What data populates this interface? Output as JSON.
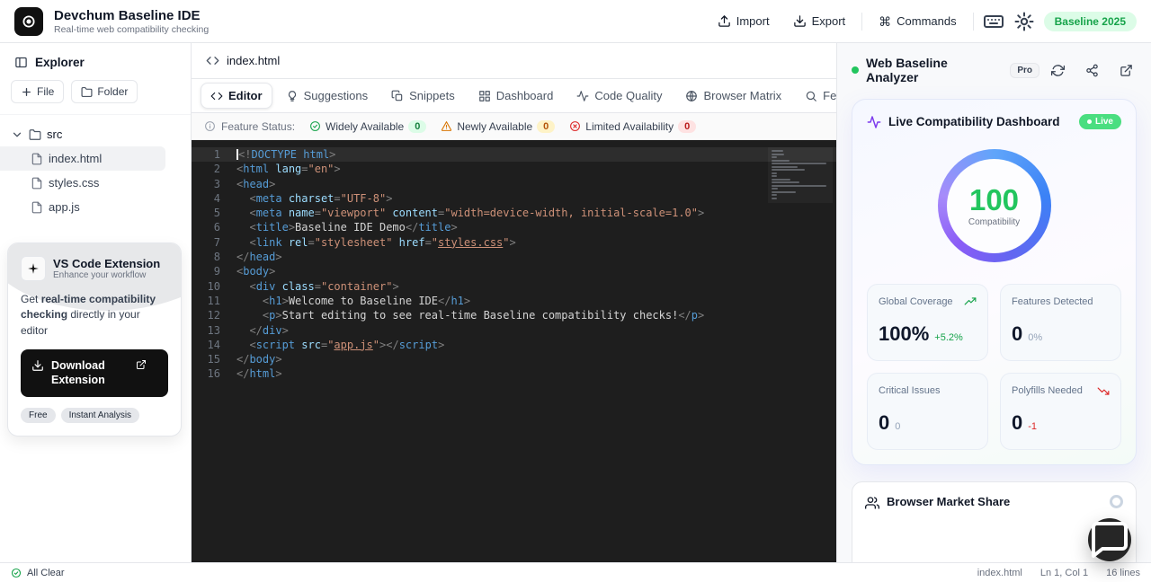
{
  "colors": {
    "accent_green": "#22c55e",
    "warning_amber": "#d97706",
    "error_red": "#dc2626",
    "editor_bg": "#1e1e1e",
    "badge_green_bg": "#dcfce7"
  },
  "header": {
    "app_title": "Devchum Baseline IDE",
    "app_subtitle": "Real-time web compatibility checking",
    "import_label": "Import",
    "export_label": "Export",
    "commands_label": "Commands",
    "commands_glyph": "⌘",
    "baseline_badge": "Baseline 2025"
  },
  "explorer": {
    "title": "Explorer",
    "file_button": "File",
    "folder_button": "Folder",
    "folder_name": "src",
    "files": [
      {
        "name": "index.html",
        "icon": "file-icon",
        "selected": true
      },
      {
        "name": "styles.css",
        "icon": "file-icon",
        "selected": false
      },
      {
        "name": "app.js",
        "icon": "file-icon",
        "selected": false
      }
    ],
    "extension_card": {
      "title": "VS Code Extension",
      "subtitle": "Enhance your workflow",
      "desc_prefix": "Get ",
      "desc_bold": "real-time compatibility checking",
      "desc_suffix": " directly in your editor",
      "download_label": "Download Extension",
      "badges": [
        "Free",
        "Instant Analysis"
      ]
    }
  },
  "editor": {
    "file_tab": "index.html",
    "tabs": [
      {
        "label": "Editor",
        "icon": "code-icon",
        "active": true
      },
      {
        "label": "Suggestions",
        "icon": "lightbulb-icon",
        "active": false
      },
      {
        "label": "Snippets",
        "icon": "snippets-icon",
        "active": false
      },
      {
        "label": "Dashboard",
        "icon": "dashboard-icon",
        "active": false
      },
      {
        "label": "Code Quality",
        "icon": "activity-icon",
        "active": false
      },
      {
        "label": "Browser Matrix",
        "icon": "globe-icon",
        "active": false
      },
      {
        "label": "Feature Explorer",
        "icon": "search-icon",
        "active": false
      }
    ],
    "feature_status": {
      "label": "Feature Status:",
      "items": [
        {
          "label": "Widely Available",
          "count": "0",
          "type": "success",
          "icon": "check-circle-icon"
        },
        {
          "label": "Newly Available",
          "count": "0",
          "type": "warning",
          "icon": "warning-triangle-icon"
        },
        {
          "label": "Limited Availability",
          "count": "0",
          "type": "error",
          "icon": "x-circle-icon"
        }
      ]
    },
    "code_lines": [
      [
        [
          "p",
          "<!"
        ],
        [
          "tag",
          "DOCTYPE"
        ],
        [
          "txt",
          " "
        ],
        [
          "tag",
          "html"
        ],
        [
          "p",
          ">"
        ]
      ],
      [
        [
          "p",
          "<"
        ],
        [
          "tag",
          "html"
        ],
        [
          "attr",
          " lang"
        ],
        [
          "p",
          "="
        ],
        [
          "str",
          "\"en\""
        ],
        [
          "p",
          ">"
        ]
      ],
      [
        [
          "p",
          "<"
        ],
        [
          "tag",
          "head"
        ],
        [
          "p",
          ">"
        ]
      ],
      [
        [
          "txt",
          "  "
        ],
        [
          "p",
          "<"
        ],
        [
          "tag",
          "meta"
        ],
        [
          "attr",
          " charset"
        ],
        [
          "p",
          "="
        ],
        [
          "str",
          "\"UTF-8\""
        ],
        [
          "p",
          ">"
        ]
      ],
      [
        [
          "txt",
          "  "
        ],
        [
          "p",
          "<"
        ],
        [
          "tag",
          "meta"
        ],
        [
          "attr",
          " name"
        ],
        [
          "p",
          "="
        ],
        [
          "str",
          "\"viewport\""
        ],
        [
          "attr",
          " content"
        ],
        [
          "p",
          "="
        ],
        [
          "str",
          "\"width=device-width, initial-scale=1.0\""
        ],
        [
          "p",
          ">"
        ]
      ],
      [
        [
          "txt",
          "  "
        ],
        [
          "p",
          "<"
        ],
        [
          "tag",
          "title"
        ],
        [
          "p",
          ">"
        ],
        [
          "txt",
          "Baseline IDE Demo"
        ],
        [
          "p",
          "</"
        ],
        [
          "tag",
          "title"
        ],
        [
          "p",
          ">"
        ]
      ],
      [
        [
          "txt",
          "  "
        ],
        [
          "p",
          "<"
        ],
        [
          "tag",
          "link"
        ],
        [
          "attr",
          " rel"
        ],
        [
          "p",
          "="
        ],
        [
          "str",
          "\"stylesheet\""
        ],
        [
          "attr",
          " href"
        ],
        [
          "p",
          "="
        ],
        [
          "str",
          "\""
        ],
        [
          "link",
          "styles.css"
        ],
        [
          "str",
          "\""
        ],
        [
          "p",
          ">"
        ]
      ],
      [
        [
          "p",
          "</"
        ],
        [
          "tag",
          "head"
        ],
        [
          "p",
          ">"
        ]
      ],
      [
        [
          "p",
          "<"
        ],
        [
          "tag",
          "body"
        ],
        [
          "p",
          ">"
        ]
      ],
      [
        [
          "txt",
          "  "
        ],
        [
          "p",
          "<"
        ],
        [
          "tag",
          "div"
        ],
        [
          "attr",
          " class"
        ],
        [
          "p",
          "="
        ],
        [
          "str",
          "\"container\""
        ],
        [
          "p",
          ">"
        ]
      ],
      [
        [
          "txt",
          "    "
        ],
        [
          "p",
          "<"
        ],
        [
          "tag",
          "h1"
        ],
        [
          "p",
          ">"
        ],
        [
          "txt",
          "Welcome to Baseline IDE"
        ],
        [
          "p",
          "</"
        ],
        [
          "tag",
          "h1"
        ],
        [
          "p",
          ">"
        ]
      ],
      [
        [
          "txt",
          "    "
        ],
        [
          "p",
          "<"
        ],
        [
          "tag",
          "p"
        ],
        [
          "p",
          ">"
        ],
        [
          "txt",
          "Start editing to see real-time Baseline compatibility checks!"
        ],
        [
          "p",
          "</"
        ],
        [
          "tag",
          "p"
        ],
        [
          "p",
          ">"
        ]
      ],
      [
        [
          "txt",
          "  "
        ],
        [
          "p",
          "</"
        ],
        [
          "tag",
          "div"
        ],
        [
          "p",
          ">"
        ]
      ],
      [
        [
          "txt",
          "  "
        ],
        [
          "p",
          "<"
        ],
        [
          "tag",
          "script"
        ],
        [
          "attr",
          " src"
        ],
        [
          "p",
          "="
        ],
        [
          "str",
          "\""
        ],
        [
          "link",
          "app.js"
        ],
        [
          "str",
          "\""
        ],
        [
          "p",
          ">"
        ],
        [
          "p",
          "</"
        ],
        [
          "tag",
          "script"
        ],
        [
          "p",
          ">"
        ]
      ],
      [
        [
          "p",
          "</"
        ],
        [
          "tag",
          "body"
        ],
        [
          "p",
          ">"
        ]
      ],
      [
        [
          "p",
          "</"
        ],
        [
          "tag",
          "html"
        ],
        [
          "p",
          ">"
        ]
      ]
    ]
  },
  "analyzer": {
    "title": "Web Baseline Analyzer",
    "pro_badge": "Pro",
    "dashboard": {
      "title": "Live Compatibility Dashboard",
      "live_badge": "Live",
      "score": "100",
      "score_label": "Compatibility",
      "stats": [
        {
          "label": "Global Coverage",
          "value": "100%",
          "delta": "+5.2%",
          "trend": "up"
        },
        {
          "label": "Features Detected",
          "value": "0",
          "delta": "0%",
          "trend": "none"
        },
        {
          "label": "Critical Issues",
          "value": "0",
          "delta": "0",
          "trend": "none"
        },
        {
          "label": "Polyfills Needed",
          "value": "0",
          "delta": "-1",
          "trend": "down"
        }
      ]
    },
    "market_share": {
      "title": "Browser Market Share"
    }
  },
  "status_bar": {
    "status": "All Clear",
    "file": "index.html",
    "cursor": "Ln 1, Col 1",
    "lines": "16 lines"
  }
}
